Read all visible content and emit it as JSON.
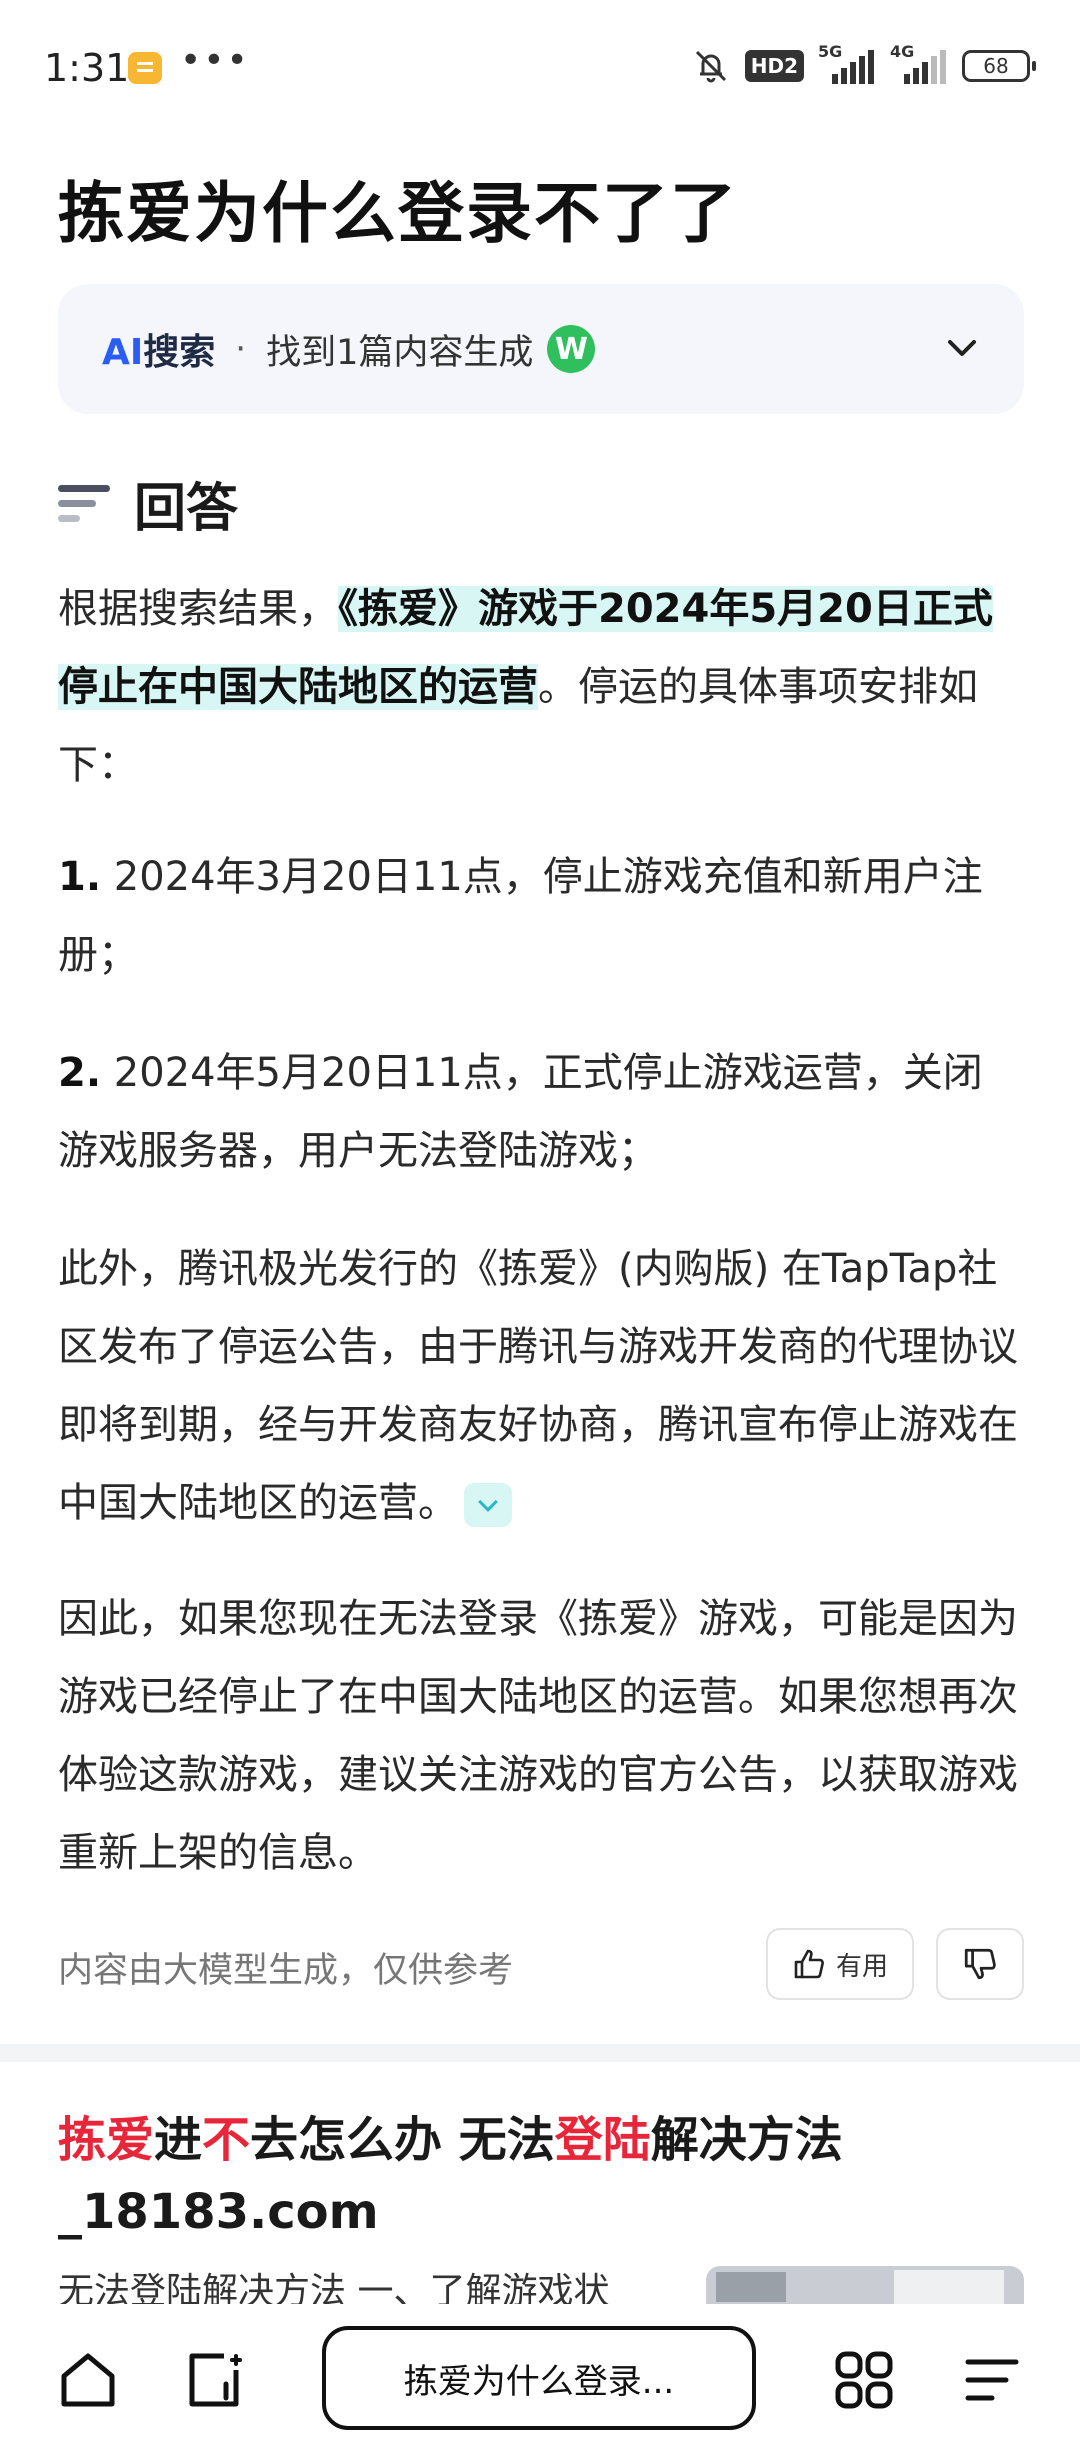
{
  "status_bar": {
    "time": "1:31",
    "dots": "•••",
    "hd": "HD2",
    "sig1_label": "5G",
    "sig2_label": "4G",
    "battery": "68"
  },
  "page": {
    "title": "拣爱为什么登录不了了"
  },
  "ai_search": {
    "ai": "AI",
    "search": "搜索",
    "sep": "·",
    "found_text": "找到1篇内容生成",
    "source_badge": "W"
  },
  "answer": {
    "title": "回答",
    "intro_prefix": "根据搜索结果，",
    "intro_highlight": "《拣爱》游戏于2024年5月20日正式停止在中国大陆地区的运营",
    "intro_suffix": "。停运的具体事项安排如下：",
    "item1_num": "1.",
    "item1_text": " 2024年3月20日11点，停止游戏充值和新用户注册；",
    "item2_num": "2.",
    "item2_text": " 2024年5月20日11点，正式停止游戏运营，关闭游戏服务器，用户无法登陆游戏；",
    "para3": "此外，腾讯极光发行的《拣爱》(内购版) 在TapTap社区发布了停运公告，由于腾讯与游戏开发商的代理协议即将到期，经与开发商友好协商，腾讯宣布停止游戏在中国大陆地区的运营。",
    "para4": "因此，如果您现在无法登录《拣爱》游戏，可能是因为游戏已经停止了在中国大陆地区的运营。如果您想再次体验这款游戏，建议关注游戏的官方公告，以获取游戏重新上架的信息。",
    "disclaimer": "内容由大模型生成，仅供参考",
    "useful_label": "有用"
  },
  "result": {
    "title_red1": "拣爱",
    "title_mid1": "进",
    "title_red2": "不",
    "title_mid2": "去怎么办 无法",
    "title_red3": "登陆",
    "title_end": "解决方法_18183.com",
    "snippet": "无法登陆解决方法 一、了解游戏状"
  },
  "bottom_nav": {
    "search_text": "拣爱为什么登录..."
  }
}
